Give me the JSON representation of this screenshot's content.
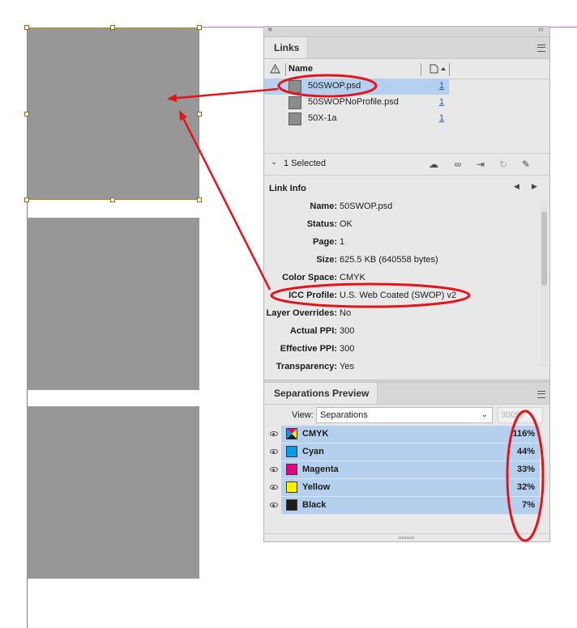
{
  "links_panel": {
    "tab_label": "Links",
    "columns": {
      "name": "Name"
    },
    "items": [
      {
        "name": "50SWOP.psd",
        "page": "1"
      },
      {
        "name": "50SWOPNoProfile.psd",
        "page": "1"
      },
      {
        "name": "50X-1a",
        "page": "1"
      }
    ],
    "selection_count": "1 Selected",
    "link_info_title": "Link Info",
    "link_info": [
      {
        "label": "Name:",
        "value": "50SWOP.psd"
      },
      {
        "label": "Status:",
        "value": "OK"
      },
      {
        "label": "Page:",
        "value": "1"
      },
      {
        "label": "Size:",
        "value": "625.5 KB (640558 bytes)"
      },
      {
        "label": "Color Space:",
        "value": "CMYK"
      },
      {
        "label": "ICC Profile:",
        "value": "U.S. Web Coated (SWOP) v2"
      },
      {
        "label": "Layer Overrides:",
        "value": "No"
      },
      {
        "label": "Actual PPI:",
        "value": "300"
      },
      {
        "label": "Effective PPI:",
        "value": "300"
      },
      {
        "label": "Transparency:",
        "value": "Yes"
      }
    ]
  },
  "separations_panel": {
    "tab_label": "Separations Preview",
    "view_label": "View:",
    "view_value": "Separations",
    "zoom_value": "300%",
    "rows": [
      {
        "name": "CMYK",
        "percent": "116%",
        "color": "cmyk"
      },
      {
        "name": "Cyan",
        "percent": "44%",
        "color": "#00a0e3"
      },
      {
        "name": "Magenta",
        "percent": "33%",
        "color": "#e6007e"
      },
      {
        "name": "Yellow",
        "percent": "32%",
        "color": "#ffed00"
      },
      {
        "name": "Black",
        "percent": "7%",
        "color": "#1d1d1b"
      }
    ]
  },
  "colors": {
    "selection": "#b5d0ef",
    "annotation": "#e3151a",
    "guide": "#a25fc7",
    "frame_fill": "#979798"
  }
}
